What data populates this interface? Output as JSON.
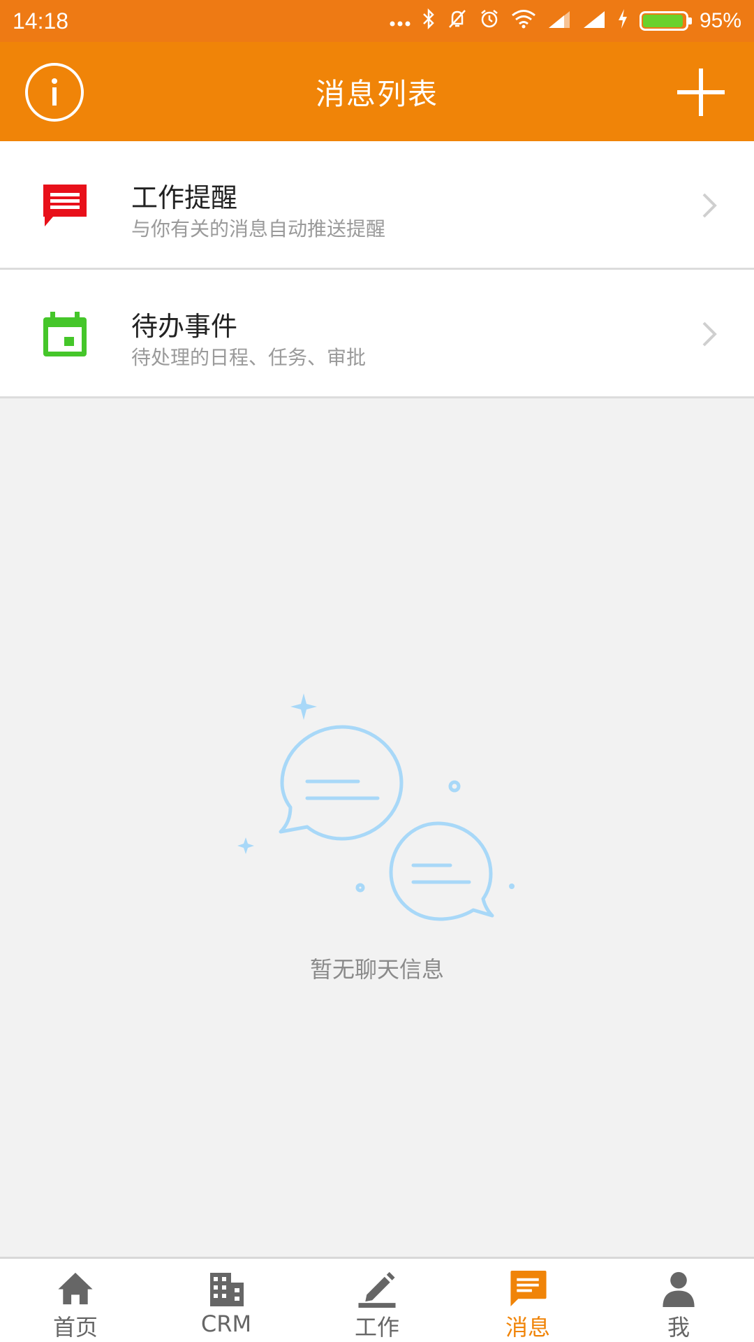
{
  "status_bar": {
    "time": "14:18",
    "battery_percent": "95%",
    "battery_level": 0.95,
    "icons": [
      "more-dots-icon",
      "bluetooth-icon",
      "mute-icon",
      "alarm-icon",
      "wifi-icon",
      "signal-icon",
      "signal-icon",
      "charging-icon",
      "battery-icon"
    ]
  },
  "app_bar": {
    "title": "消息列表",
    "left_icon": "info-icon",
    "right_icon": "plus-icon",
    "color": "#f08408"
  },
  "list": [
    {
      "title": "工作提醒",
      "subtitle": "与你有关的消息自动推送提醒",
      "icon": "message-icon",
      "icon_color": "#e8101a"
    },
    {
      "title": "待办事件",
      "subtitle": "待处理的日程、任务、审批",
      "icon": "calendar-icon",
      "icon_color": "#45c62a"
    }
  ],
  "empty_state": {
    "text": "暂无聊天信息",
    "icon": "chat-bubbles-illustration",
    "color": "#9fd4f6"
  },
  "tab_bar": {
    "active_color": "#f08408",
    "tabs": [
      {
        "label": "首页",
        "icon": "home-icon",
        "active": false
      },
      {
        "label": "CRM",
        "icon": "building-icon",
        "active": false
      },
      {
        "label": "工作",
        "icon": "pencil-icon",
        "active": false
      },
      {
        "label": "消息",
        "icon": "message-icon",
        "active": true
      },
      {
        "label": "我",
        "icon": "person-icon",
        "active": false
      }
    ]
  }
}
